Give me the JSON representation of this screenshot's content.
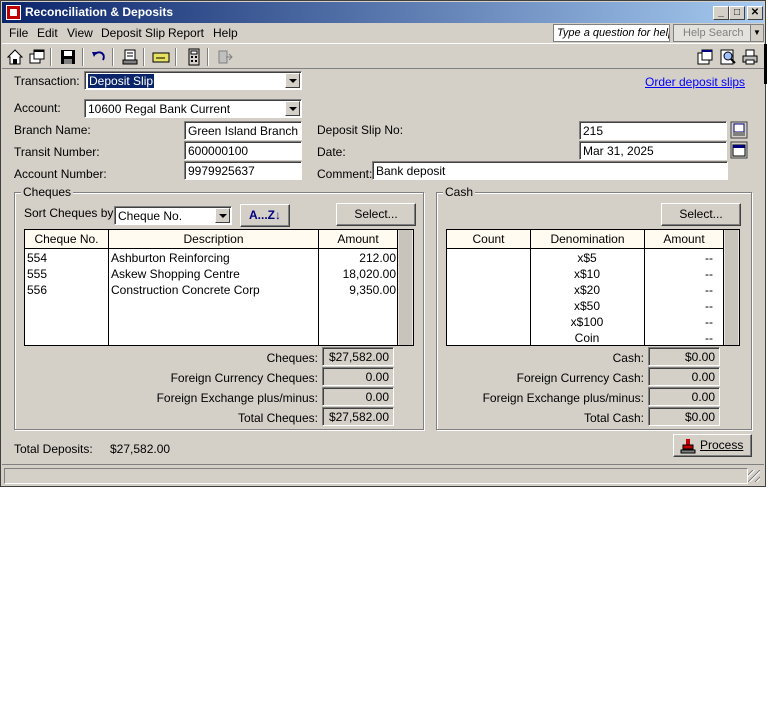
{
  "window": {
    "title": "Reconciliation & Deposits",
    "controls": [
      "minimize",
      "maximize",
      "close"
    ]
  },
  "menu": {
    "items": [
      "File",
      "Edit",
      "View",
      "Deposit Slip",
      "Report",
      "Help"
    ],
    "help_question_placeholder": "Type a question for help",
    "help_search_label": "Help Search"
  },
  "toolbar": {
    "icons": [
      "home-icon",
      "windows-icon",
      "save-icon",
      "undo-icon",
      "deposit-icon",
      "cheque-icon",
      "calculator-icon",
      "transfer-icon",
      "new-window-icon",
      "preview-icon",
      "print-icon"
    ]
  },
  "form": {
    "transaction_label": "Transaction:",
    "transaction_value": "Deposit Slip",
    "order_link": "Order deposit slips",
    "account_label": "Account:",
    "account_value": "10600 Regal Bank Current",
    "branch_label": "Branch Name:",
    "branch_value": "Green Island Branch",
    "transit_label": "Transit Number:",
    "transit_value": "600000100",
    "acctnum_label": "Account Number:",
    "acctnum_value": "9979925637",
    "slipno_label": "Deposit Slip No:",
    "slipno_value": "215",
    "date_label": "Date:",
    "date_value": "Mar 31, 2025",
    "comment_label": "Comment:",
    "comment_value": "Bank deposit"
  },
  "cheques": {
    "group_title": "Cheques",
    "sort_label": "Sort Cheques by:",
    "sort_value": "Cheque No.",
    "az_button": "A...Z",
    "select_button": "Select...",
    "columns": [
      "Cheque No.",
      "Description",
      "Amount"
    ],
    "rows": [
      {
        "no": "554",
        "desc": "Ashburton Reinforcing",
        "amount": "212.00"
      },
      {
        "no": "555",
        "desc": "Askew Shopping Centre",
        "amount": "18,020.00"
      },
      {
        "no": "556",
        "desc": "Construction Concrete Corp",
        "amount": "9,350.00"
      }
    ],
    "cheques_label": "Cheques:",
    "cheques_value": "$27,582.00",
    "fc_label": "Foreign Currency Cheques:",
    "fc_value": "0.00",
    "fx_label": "Foreign Exchange plus/minus:",
    "fx_value": "0.00",
    "total_label": "Total Cheques:",
    "total_value": "$27,582.00"
  },
  "cash": {
    "group_title": "Cash",
    "select_button": "Select...",
    "columns": [
      "Count",
      "Denomination",
      "Amount"
    ],
    "rows": [
      {
        "count": "",
        "denom": "x$5",
        "amount": "--"
      },
      {
        "count": "",
        "denom": "x$10",
        "amount": "--"
      },
      {
        "count": "",
        "denom": "x$20",
        "amount": "--"
      },
      {
        "count": "",
        "denom": "x$50",
        "amount": "--"
      },
      {
        "count": "",
        "denom": "x$100",
        "amount": "--"
      },
      {
        "count": "",
        "denom": "Coin",
        "amount": "--"
      }
    ],
    "cash_label": "Cash:",
    "cash_value": "$0.00",
    "fc_label": "Foreign Currency Cash:",
    "fc_value": "0.00",
    "fx_label": "Foreign Exchange plus/minus:",
    "fx_value": "0.00",
    "total_label": "Total Cash:",
    "total_value": "$0.00"
  },
  "footer": {
    "total_deposits_label": "Total Deposits:",
    "total_deposits_value": "$27,582.00",
    "process_button": "Process"
  },
  "colors": {
    "title_gradient_start": "#0a246a",
    "title_gradient_end": "#a6caf0",
    "window_face": "#d4d0c8",
    "grid_header": "#fffbf0",
    "link": "#0000ff"
  }
}
